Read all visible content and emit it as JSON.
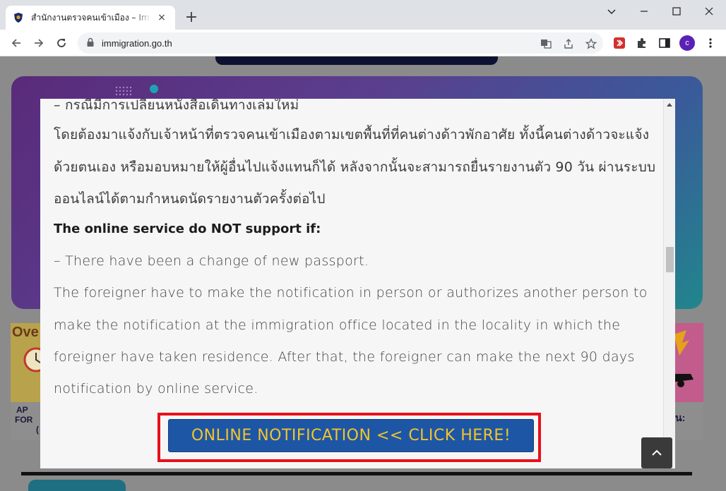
{
  "browser": {
    "tab_title": "สำนักงานตรวจคนเข้าเมือง – Immigration Bureau",
    "tab_close": "×",
    "new_tab": "+",
    "url": "immigration.go.th",
    "profile_initial": "c"
  },
  "modal": {
    "lines": [
      "– กรณีมีการเปลี่ยนหนังสือเดินทางเล่มใหม่",
      "โดยต้องมาแจ้งกับเจ้าหน้าที่ตรวจคนเข้าเมืองตามเขตพื้นที่ที่คนต่างด้าวพักอาศัย ทั้งนี้คนต่างด้าวจะแจ้ง",
      "ด้วยตนเอง หรือมอบหมายให้ผู้อื่นไปแจ้งแทนก็ได้ หลังจากนั้นจะสามารถยื่นรายงานตัว 90 วัน ผ่านระบบ",
      "ออนไลน์ได้ตามกำหนดนัดรายงานตัวครั้งต่อไป",
      "The online service do NOT support if:",
      "– There have been a change of new passport.",
      "The foreigner have to make the notification in person or authorizes another person to",
      "make the notification at the immigration office located in the locality in which the",
      "foreigner have taken residence. After that, the foreigner can make the next 90 days",
      "notification by online service."
    ],
    "cta_label": "ONLINE NOTIFICATION << CLICK HERE!"
  },
  "background": {
    "card_left_top": "Ove",
    "card_left_bottom": [
      "AP",
      "FOR",
      "("
    ],
    "card_right_bottom": "น:"
  },
  "colors": {
    "cta_background": "#1e56a6",
    "cta_text": "#f2c52a",
    "cta_frame": "#e8101a"
  }
}
